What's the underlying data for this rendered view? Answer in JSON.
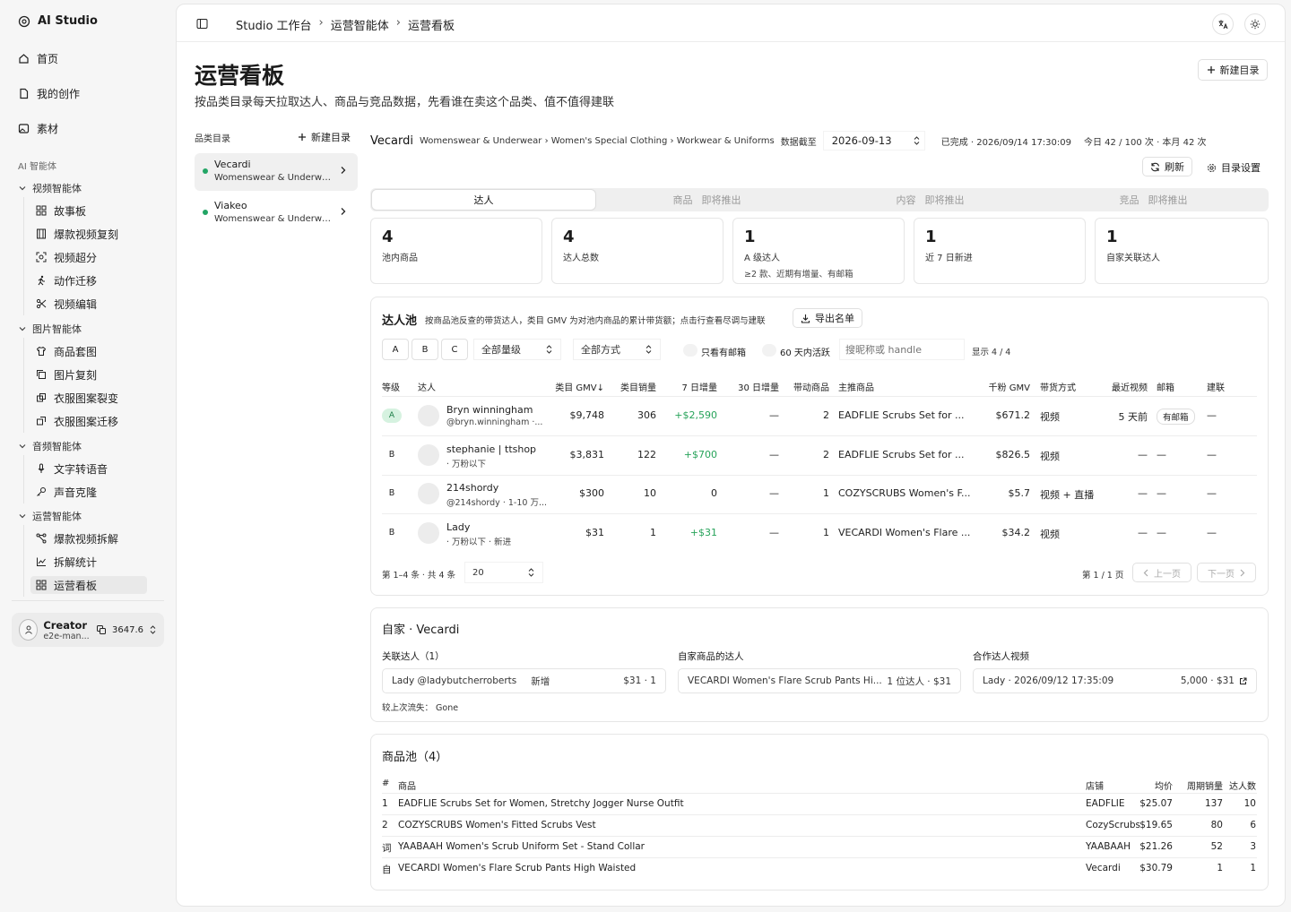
{
  "app": {
    "name": "AI Studio"
  },
  "sidebar": {
    "top": [
      {
        "label": "首页"
      },
      {
        "label": "我的创作"
      },
      {
        "label": "素材"
      }
    ],
    "section_label": "AI 智能体",
    "groups": [
      {
        "label": "视频智能体",
        "items": [
          {
            "label": "故事板"
          },
          {
            "label": "爆款视频复刻"
          },
          {
            "label": "视频超分"
          },
          {
            "label": "动作迁移"
          },
          {
            "label": "视频编辑"
          }
        ]
      },
      {
        "label": "图片智能体",
        "items": [
          {
            "label": "商品套图"
          },
          {
            "label": "图片复刻"
          },
          {
            "label": "衣服图案裂变"
          },
          {
            "label": "衣服图案迁移"
          }
        ]
      },
      {
        "label": "音频智能体",
        "items": [
          {
            "label": "文字转语音"
          },
          {
            "label": "声音克隆"
          }
        ]
      },
      {
        "label": "运营智能体",
        "items": [
          {
            "label": "爆款视频拆解"
          },
          {
            "label": "拆解统计"
          },
          {
            "label": "运营看板"
          }
        ]
      }
    ],
    "user": {
      "name": "Creator",
      "handle": "e2e-man...",
      "credits": "3647.6"
    }
  },
  "breadcrumb": [
    "Studio 工作台",
    "运营智能体",
    "运营看板"
  ],
  "page": {
    "title": "运营看板",
    "subtitle": "按品类目录每天拉取达人、商品与竞品数据，先看谁在卖这个品类、值不值得建联",
    "new_dir_label": "新建目录"
  },
  "catalog": {
    "title": "品类目录",
    "new_label": "新建目录",
    "items": [
      {
        "name": "Vecardi",
        "path": "Womenswear & Underwe..."
      },
      {
        "name": "Viakeo",
        "path": "Womenswear & Underwe..."
      }
    ]
  },
  "info": {
    "brand": "Vecardi",
    "path": "Womenswear & Underwear › Women's Special Clothing › Workwear & Uniforms",
    "date_label": "数据截至",
    "date": "2026-09-13",
    "status": "已完成 · 2026/09/14 17:30:09",
    "quota": "今日 42 / 100 次 · 本月 42 次",
    "refresh": "刷新",
    "settings": "目录设置"
  },
  "tabs": [
    {
      "label": "达人",
      "tag": ""
    },
    {
      "label": "商品",
      "tag": "即将推出"
    },
    {
      "label": "内容",
      "tag": "即将推出"
    },
    {
      "label": "竞品",
      "tag": "即将推出"
    }
  ],
  "stats": [
    {
      "value": "4",
      "label": "池内商品",
      "hint": ""
    },
    {
      "value": "4",
      "label": "达人总数",
      "hint": ""
    },
    {
      "value": "1",
      "label": "A 级达人",
      "hint": "≥2 款、近期有增量、有邮箱"
    },
    {
      "value": "1",
      "label": "近 7 日新进",
      "hint": ""
    },
    {
      "value": "1",
      "label": "自家关联达人",
      "hint": ""
    }
  ],
  "pool": {
    "title": "达人池",
    "desc": "按商品池反查的带货达人，类目 GMV 为对池内商品的累计带货额；点击行查看尽调与建联",
    "export": "导出名单",
    "grades": [
      "A",
      "B",
      "C"
    ],
    "level_select": "全部量级",
    "mode_select": "全部方式",
    "email_toggle": "只看有邮箱",
    "active_toggle": "60 天内活跃",
    "search_placeholder": "搜昵称或 handle",
    "shown": "显示 4 / 4",
    "headers": [
      "等级",
      "达人",
      "类目 GMV↓",
      "类目销量",
      "7 日增量",
      "30 日增量",
      "带动商品",
      "主推商品",
      "千粉 GMV",
      "带货方式",
      "最近视频",
      "邮箱",
      "建联"
    ],
    "rows": [
      {
        "grade": "A",
        "name": "Bryn winningham",
        "sub": "@bryn.winningham ·...",
        "gmv": "$9,748",
        "sales": "306",
        "d7": "+$2,590",
        "d30": "—",
        "items": "2",
        "main": "EADFLIE Scrubs Set for ...",
        "kgmv": "$671.2",
        "mode": "视频",
        "recent": "5 天前",
        "email": "有邮箱",
        "contact": "—"
      },
      {
        "grade": "B",
        "name": "stephanie | ttshop",
        "sub": "· 万粉以下",
        "gmv": "$3,831",
        "sales": "122",
        "d7": "+$700",
        "d30": "—",
        "items": "2",
        "main": "EADFLIE Scrubs Set for ...",
        "kgmv": "$826.5",
        "mode": "视频",
        "recent": "—",
        "email": "—",
        "contact": "—"
      },
      {
        "grade": "B",
        "name": "214shordy",
        "sub": "@214shordy · 1-10 万...",
        "gmv": "$300",
        "sales": "10",
        "d7": "0",
        "d30": "—",
        "items": "1",
        "main": "COZYSCRUBS Women's F...",
        "kgmv": "$5.7",
        "mode": "视频 + 直播",
        "recent": "—",
        "email": "—",
        "contact": "—"
      },
      {
        "grade": "B",
        "name": "Lady",
        "sub": "· 万粉以下 · 新进",
        "gmv": "$31",
        "sales": "1",
        "d7": "+$31",
        "d30": "—",
        "items": "1",
        "main": "VECARDI Women's Flare ...",
        "kgmv": "$34.2",
        "mode": "视频",
        "recent": "—",
        "email": "—",
        "contact": "—"
      }
    ],
    "footer": {
      "range": "第 1–4 条 · 共 4 条",
      "page_size": "20",
      "page": "第 1 / 1 页",
      "prev": "上一页",
      "next": "下一页"
    }
  },
  "own": {
    "title": "自家 · Vecardi",
    "col1_title": "关联达人（1）",
    "col1_item": {
      "name": "Lady @ladybutcherroberts",
      "tag": "新增",
      "value": "$31 · 1"
    },
    "col2_title": "自家商品的达人",
    "col2_item": {
      "name": "VECARDI Women's Flare Scrub Pants Hi...",
      "value": "1 位达人 · $31"
    },
    "col3_title": "合作达人视频",
    "col3_item": {
      "name": "Lady · 2026/09/12 17:35:09",
      "value": "5,000 · $31"
    },
    "lost": "较上次流失： Gone"
  },
  "products": {
    "title": "商品池（4）",
    "headers": [
      "#",
      "商品",
      "店铺",
      "均价",
      "周期销量",
      "达人数"
    ],
    "rows": [
      {
        "idx": "1",
        "name": "EADFLIE Scrubs Set for Women, Stretchy Jogger Nurse Outfit",
        "shop": "EADFLIE",
        "price": "$25.07",
        "sales": "137",
        "kols": "10"
      },
      {
        "idx": "2",
        "name": "COZYSCRUBS Women's Fitted Scrubs Vest",
        "shop": "CozyScrubs",
        "price": "$19.65",
        "sales": "80",
        "kols": "6"
      },
      {
        "idx": "词",
        "name": "YAABAAH Women's Scrub Uniform Set - Stand Collar",
        "shop": "YAABAAH",
        "price": "$21.26",
        "sales": "52",
        "kols": "3"
      },
      {
        "idx": "自",
        "name": "VECARDI Women's Flare Scrub Pants High Waisted",
        "shop": "Vecardi",
        "price": "$30.79",
        "sales": "1",
        "kols": "1"
      }
    ]
  }
}
